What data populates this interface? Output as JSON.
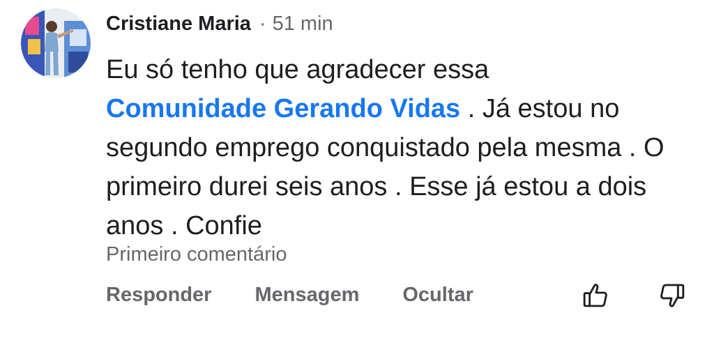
{
  "comment": {
    "author": "Cristiane Maria",
    "separator": "·",
    "time": "51 min",
    "text_before": "Eu só tenho que agradecer essa",
    "mention": "Comunidade Gerando Vidas",
    "text_after": " . Já estou no segundo emprego conquistado pela mesma . O primeiro durei seis anos . Esse já estou a dois anos . Confie",
    "first_comment_label": "Primeiro comentário"
  },
  "actions": {
    "reply": "Responder",
    "message": "Mensagem",
    "hide": "Ocultar"
  },
  "icons": {
    "like": "thumbs-up-icon",
    "dislike": "thumbs-down-icon"
  },
  "colors": {
    "mention": "#1877f2",
    "primary_text": "#1c1e21",
    "secondary_text": "#65676b"
  }
}
